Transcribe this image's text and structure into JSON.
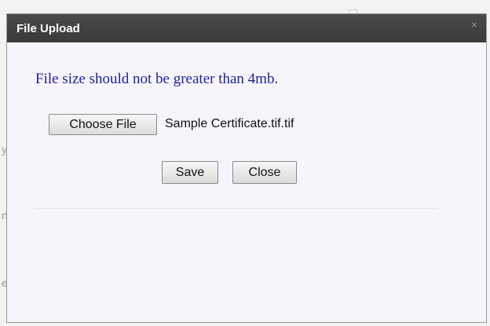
{
  "dialog": {
    "title": "File Upload",
    "close_glyph": "×",
    "message": "File size should not be greater than 4mb.",
    "choose_file_label": "Choose File",
    "selected_file": "Sample Certificate.tif.tif",
    "save_label": "Save",
    "close_label": "Close"
  },
  "background": {
    "fragments": [
      "y",
      "n",
      "e"
    ]
  },
  "colors": {
    "titlebar": "#3f3f3f",
    "message_text": "#1f1f99",
    "dialog_body": "#f5f5fb"
  },
  "icons": {
    "close": "close-icon"
  }
}
